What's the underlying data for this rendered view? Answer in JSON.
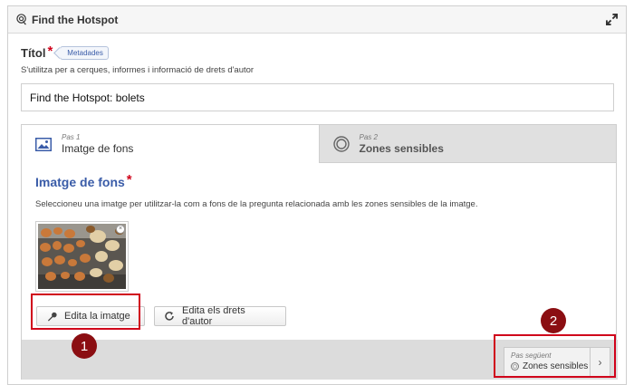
{
  "header": {
    "title": "Find the Hotspot",
    "icon": "hotspot-icon",
    "expand_icon": "expand-icon"
  },
  "title_field": {
    "label": "Títol",
    "required_mark": "*",
    "metadata_tag": "Metadades",
    "description": "S'utilitza per a cerques, informes i informació de drets d'autor",
    "value": "Find the Hotspot: bolets"
  },
  "tabs": [
    {
      "step": "Pas 1",
      "label": "Imatge de fons",
      "icon": "image-icon",
      "active": true
    },
    {
      "step": "Pas 2",
      "label": "Zones sensibles",
      "icon": "target-icon",
      "active": false
    }
  ],
  "background_section": {
    "title": "Imatge de fons",
    "required_mark": "*",
    "description": "Seleccioneu una imatge per utilitzar-la com a fons de la pregunta relacionada amb les zones sensibles de la imatge.",
    "remove_glyph": "×"
  },
  "buttons": {
    "edit_image": "Edita la imatge",
    "edit_copyright": "Edita els drets d'autor"
  },
  "next_step": {
    "step": "Pas següent",
    "label": "Zones sensibles",
    "arrow": "›"
  },
  "annotations": {
    "badge_1": "1",
    "badge_2": "2"
  },
  "colors": {
    "accent_blue": "#3a5ca8",
    "required_red": "#d0021b",
    "annotation_red": "#d0021b",
    "badge_dark_red": "#8b0e12"
  }
}
